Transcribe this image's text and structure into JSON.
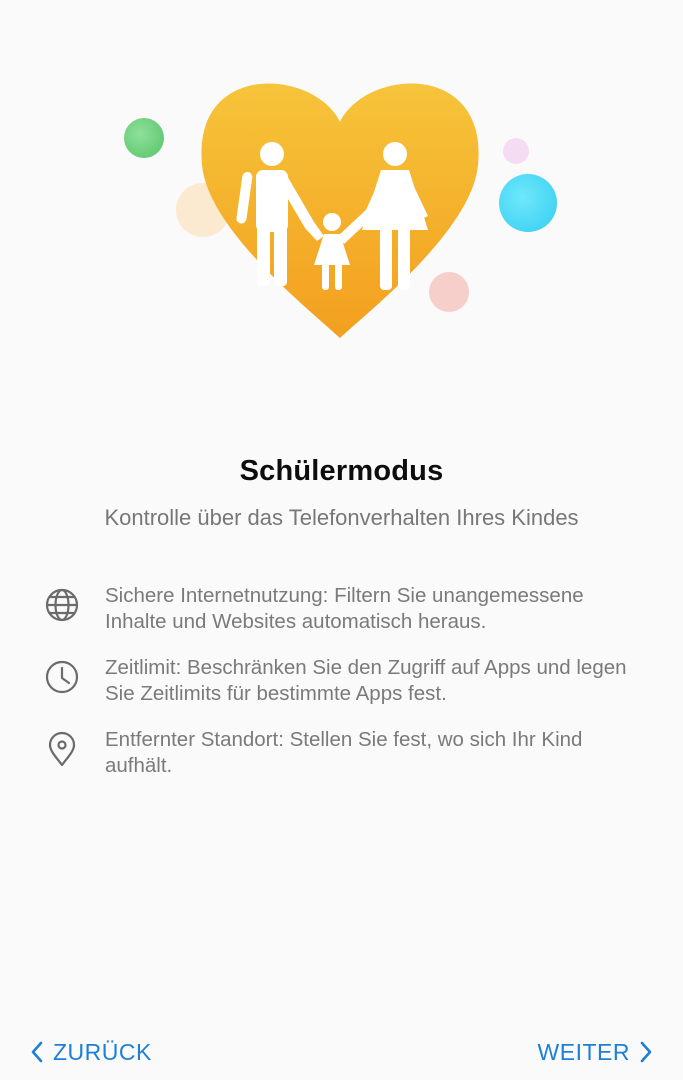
{
  "header": {
    "title": "Schülermodus",
    "subtitle": "Kontrolle über das Telefonverhalten Ihres Kindes"
  },
  "features": [
    {
      "icon": "globe-icon",
      "text": "Sichere Internetnutzung: Filtern Sie unangemessene Inhalte und Websites automatisch heraus."
    },
    {
      "icon": "clock-icon",
      "text": "Zeitlimit: Beschränken Sie den Zugriff auf Apps und legen Sie Zeitlimits für bestimmte Apps fest."
    },
    {
      "icon": "location-pin-icon",
      "text": "Entfernter Standort: Stellen Sie fest, wo sich Ihr Kind aufhält."
    }
  ],
  "navigation": {
    "back_label": "ZURÜCK",
    "next_label": "WEITER"
  },
  "colors": {
    "accent": "#1e7fd6",
    "heart_top": "#f6c33a",
    "heart_bottom": "#f3a01f",
    "bubble_green": "#6fd27e",
    "bubble_cyan": "#4fdcf7",
    "bubble_pink": "#f6c9c5",
    "bubble_lilac": "#f4dcf2",
    "bubble_cream": "#fbead0"
  }
}
